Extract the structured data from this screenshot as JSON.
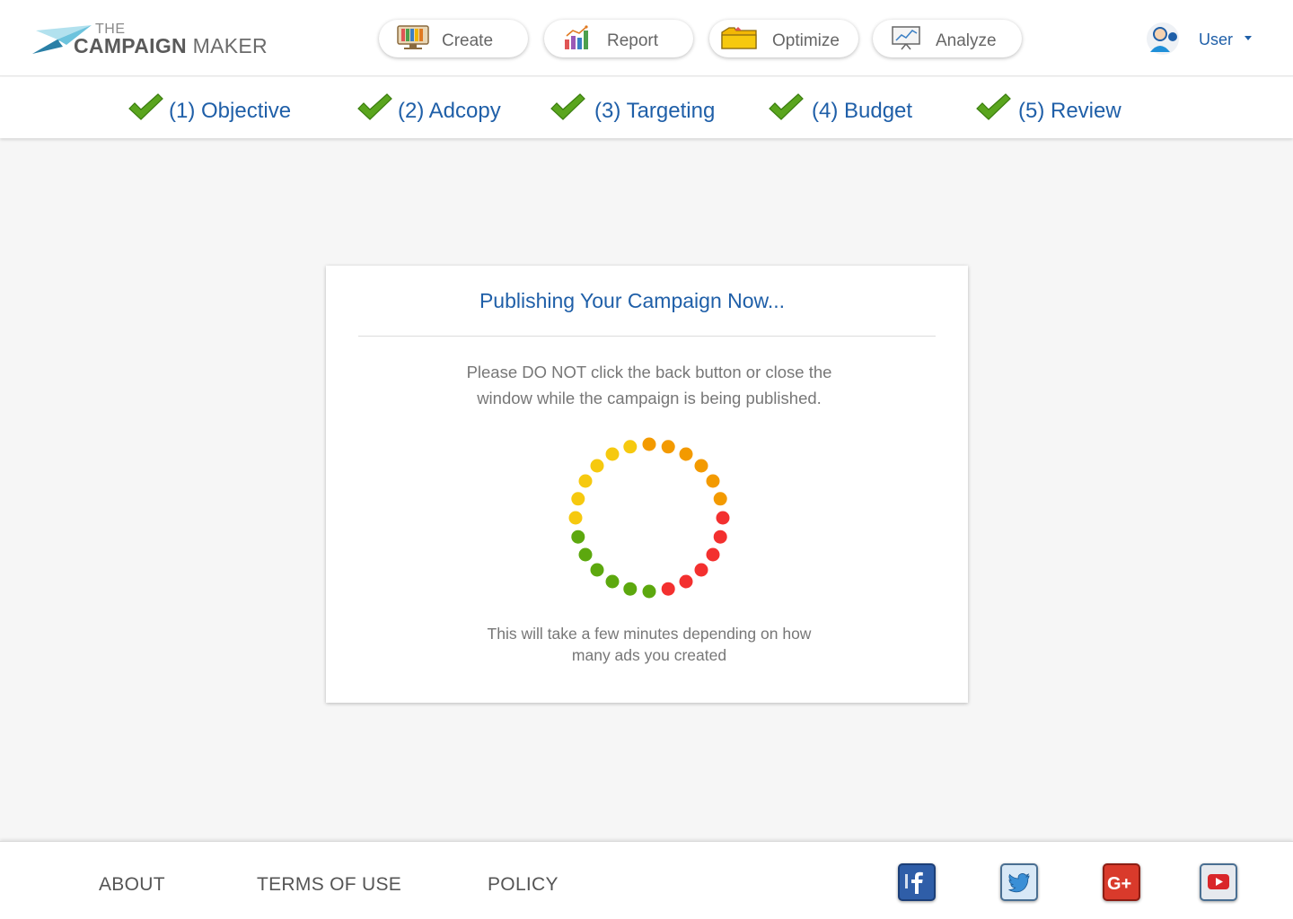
{
  "header": {
    "logo": {
      "the": "THE",
      "campaign": "CAMPAIGN",
      "maker": " MAKER"
    },
    "nav": [
      {
        "label": "Create",
        "icon": "monitor-books-icon"
      },
      {
        "label": "Report",
        "icon": "bar-chart-icon"
      },
      {
        "label": "Optimize",
        "icon": "folder-icon"
      },
      {
        "label": "Analyze",
        "icon": "presentation-board-icon"
      }
    ],
    "user": {
      "label": "User",
      "icon": "user-avatar-icon"
    }
  },
  "steps": [
    {
      "label": "(1) Objective",
      "status": "complete"
    },
    {
      "label": "(2) Adcopy",
      "status": "complete"
    },
    {
      "label": "(3) Targeting",
      "status": "complete"
    },
    {
      "label": "(4) Budget",
      "status": "complete"
    },
    {
      "label": "(5) Review",
      "status": "complete"
    }
  ],
  "modal": {
    "title": "Publishing Your Campaign Now...",
    "warning": "Please DO NOT click the back button or close the window while the campaign is being published.",
    "note": "This will take a few minutes depending on how many ads you created"
  },
  "footer": {
    "links": [
      "ABOUT",
      "TERMS OF USE",
      "POLICY"
    ],
    "social": [
      "facebook-icon",
      "twitter-icon",
      "google-plus-icon",
      "youtube-icon"
    ]
  },
  "colors": {
    "brand_blue": "#1f5fa8",
    "check_green": "#5aa51e",
    "spinner": [
      "#f3b800",
      "#f6c90f",
      "#f39a00",
      "#f3302f",
      "#5ca80e"
    ]
  }
}
